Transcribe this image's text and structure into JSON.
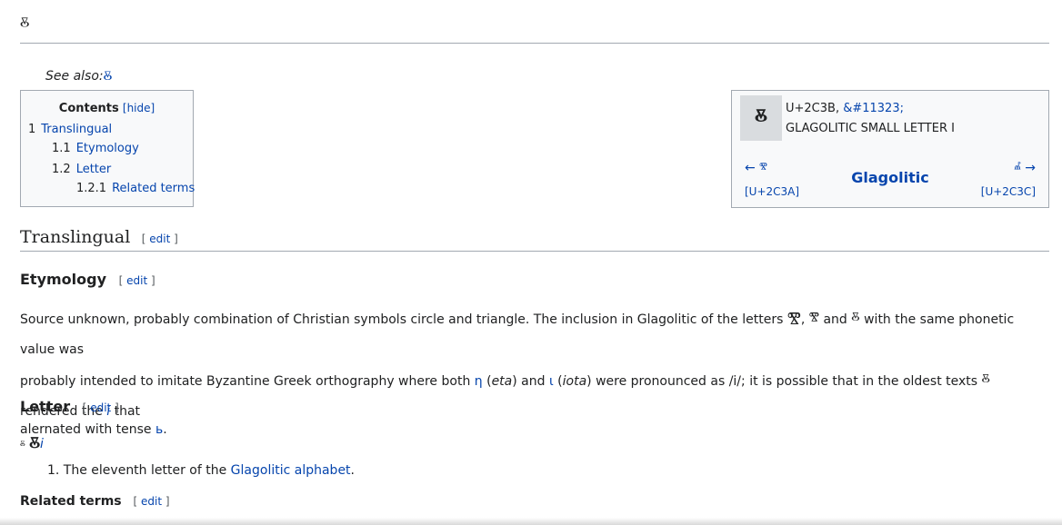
{
  "page": {
    "title": "ⰻ"
  },
  "see_also": {
    "label": "See also:",
    "glyph": "Ⰻ"
  },
  "toc": {
    "title": "Contents",
    "hide_label": "[hide]",
    "items": [
      {
        "num": "1",
        "label": "Translingual"
      },
      {
        "num": "1.1",
        "label": "Etymology"
      },
      {
        "num": "1.2",
        "label": "Letter"
      },
      {
        "num": "1.2.1",
        "label": "Related terms"
      }
    ]
  },
  "charbox": {
    "glyph": "ⰻ",
    "codepoint": "U+2C3B,",
    "entity": "&#11323;",
    "name": "GLAGOLITIC SMALL LETTER I",
    "prev": "← ⰺ",
    "prev_code": "[U+2C3A]",
    "script": "Glagolitic",
    "next": "ⰼ →",
    "next_code": "[U+2C3C]"
  },
  "sections": {
    "translingual": "Translingual",
    "etymology": "Etymology",
    "letter": "Letter",
    "related": "Related terms",
    "edit": "edit",
    "bracket_open": "[",
    "bracket_close": "]"
  },
  "etymology_text": {
    "p1": "Source unknown, probably combination of Christian symbols circle and triangle. The inclusion in Glagolitic of the letters ",
    "g1": "Ⰺ",
    "comma": ", ",
    "g2": "ⰺ",
    "and": " and ",
    "g3": "ⰻ",
    "p2": " with the same phonetic value was",
    "p3": "probably intended to imitate Byzantine Greek orthography where both ",
    "eta": "η",
    "eta_paren_open": " (",
    "eta_label": "eta",
    "eta_paren_close": ") and ",
    "iota": "ι",
    "iota_paren_open": " (",
    "iota_label": "iota",
    "iota_paren_close": ") were pronounced as /i/; it is possible that in the oldest texts ",
    "g4": "ⰻ",
    "p4": " rendered the ",
    "i_link": "i",
    "p5": " that",
    "p6": "alernated with tense ",
    "tense": "ь",
    "p7": "."
  },
  "headword": {
    "small": "ⰻ",
    "big": "Ⰻ",
    "i": "i"
  },
  "sense": {
    "num": "1.",
    "text": " The eleventh letter of the ",
    "link": "Glagolitic alphabet",
    "end": "."
  }
}
